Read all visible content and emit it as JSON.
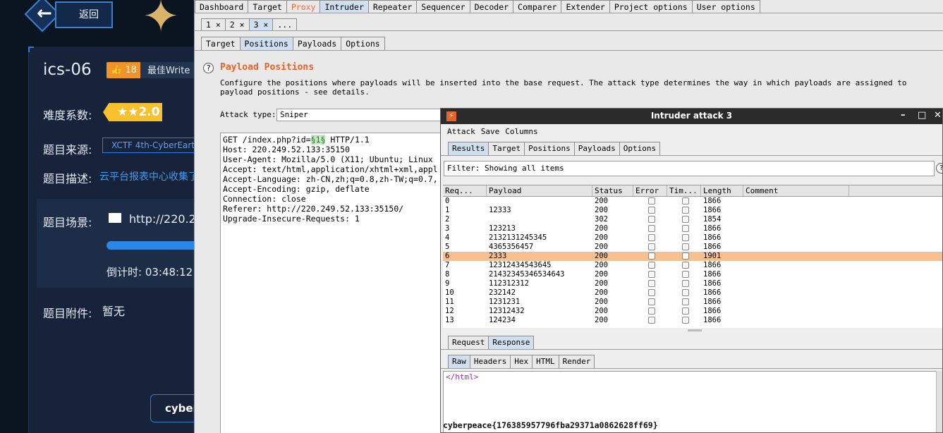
{
  "ctf": {
    "back_label": "返回",
    "challenge_title": "ics-06",
    "like_count": "18",
    "best_writeup": "最佳Write",
    "difficulty_label": "难度系数:",
    "difficulty_value": "★★2.0",
    "source_label": "题目来源:",
    "source_value": "XCTF 4th-CyberEarth",
    "desc_label": "题目描述:",
    "desc_value": "云平台报表中心收集了",
    "scene_label": "题目场景:",
    "scene_url": "http://220.2",
    "progress": 0.85,
    "countdown": "倒计时: 03:48:12",
    "attach_label": "题目附件:",
    "attach_value": "暂无",
    "cyber_btn": "cyber"
  },
  "burp": {
    "main_tabs": [
      "Dashboard",
      "Target",
      "Proxy",
      "Intruder",
      "Repeater",
      "Sequencer",
      "Decoder",
      "Comparer",
      "Extender",
      "Project options",
      "User options"
    ],
    "attack_tabs": [
      "1 ×",
      "2 ×",
      "3 ×",
      "..."
    ],
    "sub_tabs": [
      "Target",
      "Positions",
      "Payloads",
      "Options"
    ],
    "positions_title": "Payload Positions",
    "positions_desc": "Configure the positions where payloads will be inserted into the base request. The attack type determines the way in which payloads are assigned to payload positions - see details.",
    "attack_type_label": "Attack type:",
    "attack_type_value": "Sniper",
    "request_lines": [
      "Host: 220.249.52.133:35150",
      "User-Agent: Mozilla/5.0 (X11; Ubuntu; Linux",
      "Accept: text/html,application/xhtml+xml,appl",
      "Accept-Language: zh-CN,zh;q=0.8,zh-TW;q=0.7,",
      "Accept-Encoding: gzip, deflate",
      "Connection: close",
      "Referer: http://220.249.52.133:35150/",
      "Upgrade-Insecure-Requests: 1"
    ],
    "request_first": {
      "pre": "GET /index.php?id=",
      "marker": "§1§",
      "post": " HTTP/1.1"
    }
  },
  "attack": {
    "title": "Intruder attack 3",
    "menu": [
      "Attack",
      "Save",
      "Columns"
    ],
    "tabs": [
      "Results",
      "Target",
      "Positions",
      "Payloads",
      "Options"
    ],
    "filter": "Filter: Showing all items",
    "columns": [
      "Req...",
      "Payload",
      "Status",
      "Error",
      "Tim...",
      "Length",
      "Comment"
    ],
    "rows": [
      {
        "req": "0",
        "payload": "",
        "status": "200",
        "length": "1866"
      },
      {
        "req": "1",
        "payload": "12333",
        "status": "200",
        "length": "1866"
      },
      {
        "req": "2",
        "payload": "",
        "status": "302",
        "length": "1854"
      },
      {
        "req": "3",
        "payload": "123213",
        "status": "200",
        "length": "1866"
      },
      {
        "req": "4",
        "payload": "2132131245345",
        "status": "200",
        "length": "1866"
      },
      {
        "req": "5",
        "payload": "4365356457",
        "status": "200",
        "length": "1866"
      },
      {
        "req": "6",
        "payload": "2333",
        "status": "200",
        "length": "1901"
      },
      {
        "req": "7",
        "payload": "12312434543645",
        "status": "200",
        "length": "1866"
      },
      {
        "req": "8",
        "payload": "21432345346534643",
        "status": "200",
        "length": "1866"
      },
      {
        "req": "9",
        "payload": "112312312",
        "status": "200",
        "length": "1866"
      },
      {
        "req": "10",
        "payload": "232142",
        "status": "200",
        "length": "1866"
      },
      {
        "req": "11",
        "payload": "1231231",
        "status": "200",
        "length": "1866"
      },
      {
        "req": "12",
        "payload": "12312432",
        "status": "200",
        "length": "1866"
      },
      {
        "req": "13",
        "payload": "124234",
        "status": "200",
        "length": "1866"
      }
    ],
    "selected_row": 6,
    "rr_tabs": [
      "Request",
      "Response"
    ],
    "view_tabs": [
      "Raw",
      "Headers",
      "Hex",
      "HTML",
      "Render"
    ],
    "raw_close": "</html>",
    "flag": "cyberpeace{176385957796fba29371a0862628ff69}"
  }
}
